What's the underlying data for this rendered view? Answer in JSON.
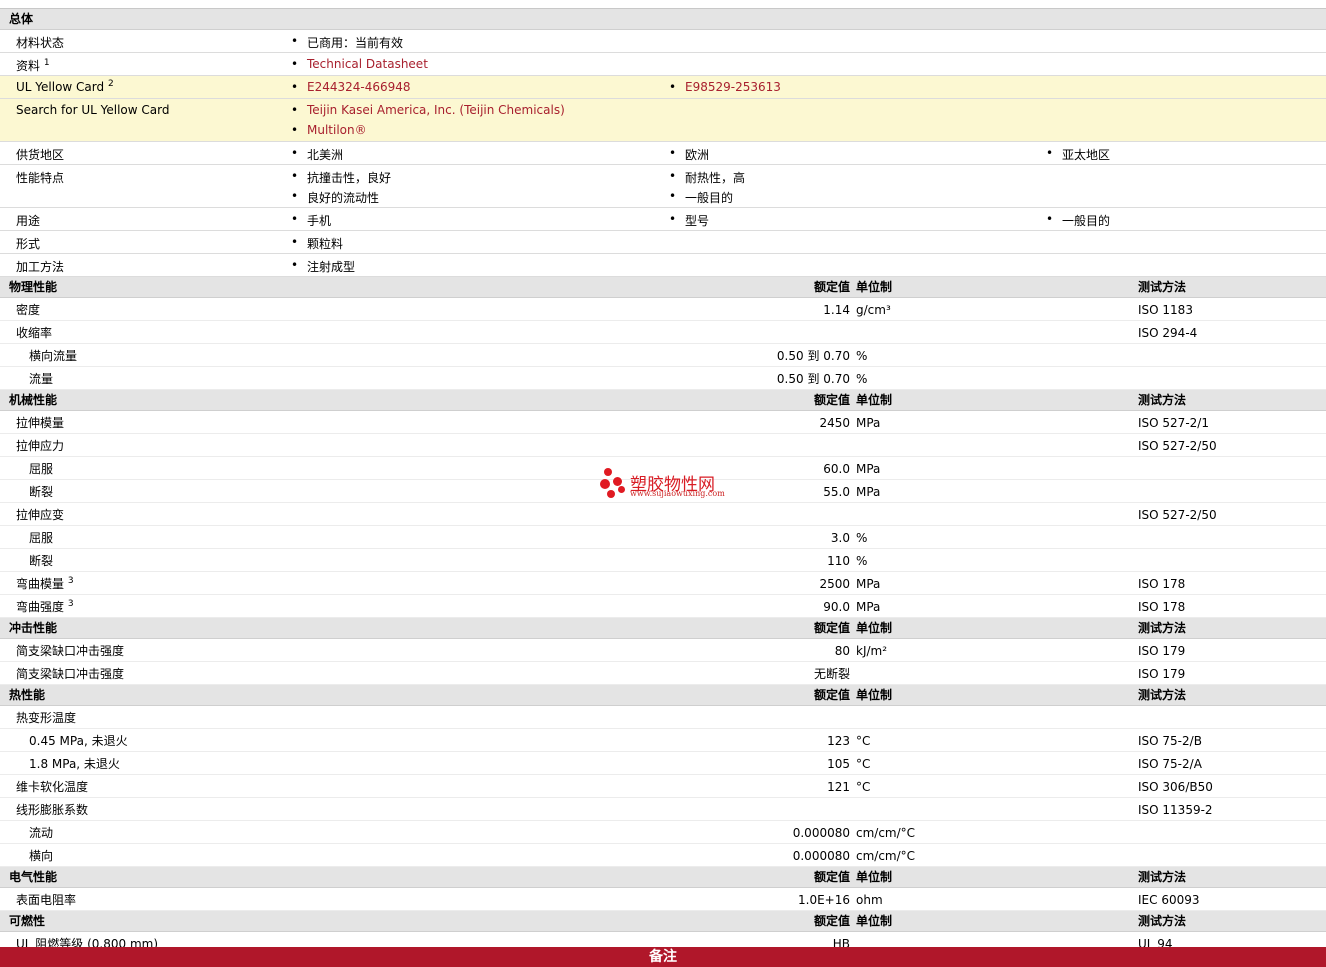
{
  "general": {
    "header": "总体",
    "material_status": {
      "label": "材料状态",
      "value": "已商用：当前有效"
    },
    "datasheet": {
      "label": "资料",
      "sup": "1",
      "link": "Technical Datasheet"
    },
    "ul_card": {
      "label": "UL Yellow Card",
      "sup": "2",
      "links": [
        "E244324-466948",
        "E98529-253613"
      ]
    },
    "search_ul": {
      "label": "Search for UL Yellow Card",
      "links": [
        "Teijin Kasei America, Inc. (Teijin Chemicals)",
        "Multilon®"
      ]
    },
    "supply": {
      "label": "供货地区",
      "items": [
        "北美洲",
        "欧洲",
        "亚太地区"
      ]
    },
    "features": {
      "label": "性能特点",
      "items": [
        "抗撞击性，良好",
        "耐热性，高",
        "良好的流动性",
        "一般目的"
      ]
    },
    "uses": {
      "label": "用途",
      "items": [
        "手机",
        "型号",
        "一般目的"
      ]
    },
    "form": {
      "label": "形式",
      "items": [
        "颗粒料"
      ]
    },
    "processing": {
      "label": "加工方法",
      "items": [
        "注射成型"
      ]
    }
  },
  "columns": {
    "nominal": "额定值",
    "unit": "单位制",
    "test": "测试方法"
  },
  "physical": {
    "header": "物理性能",
    "rows": [
      {
        "label": "密度",
        "nominal": "1.14",
        "unit": "g/cm³",
        "test": "ISO 1183"
      },
      {
        "label": "收缩率",
        "nominal": "",
        "unit": "",
        "test": "ISO 294-4"
      },
      {
        "label": "横向流量",
        "nominal": "0.50 到  0.70",
        "unit": "%",
        "test": ""
      },
      {
        "label": "流量",
        "nominal": "0.50 到  0.70",
        "unit": "%",
        "test": ""
      }
    ]
  },
  "mechanical": {
    "header": "机械性能",
    "rows": [
      {
        "label": "拉伸模量",
        "nominal": "2450",
        "unit": "MPa",
        "test": "ISO 527-2/1"
      },
      {
        "label": "拉伸应力",
        "nominal": "",
        "unit": "",
        "test": "ISO 527-2/50"
      },
      {
        "label": "屈服",
        "nominal": "60.0",
        "unit": "MPa",
        "test": ""
      },
      {
        "label": "断裂",
        "nominal": "55.0",
        "unit": "MPa",
        "test": ""
      },
      {
        "label": "拉伸应变",
        "nominal": "",
        "unit": "",
        "test": "ISO 527-2/50"
      },
      {
        "label": "屈服",
        "nominal": "3.0",
        "unit": "%",
        "test": ""
      },
      {
        "label": "断裂",
        "nominal": "110",
        "unit": "%",
        "test": ""
      },
      {
        "label": "弯曲模量",
        "sup": "3",
        "nominal": "2500",
        "unit": "MPa",
        "test": "ISO 178"
      },
      {
        "label": "弯曲强度",
        "sup": "3",
        "nominal": "90.0",
        "unit": "MPa",
        "test": "ISO 178"
      }
    ]
  },
  "impact": {
    "header": "冲击性能",
    "rows": [
      {
        "label": "简支梁缺口冲击强度",
        "nominal": "80",
        "unit": "kJ/m²",
        "test": "ISO 179"
      },
      {
        "label": "简支梁缺口冲击强度",
        "nominal": "无断裂",
        "unit": "",
        "test": "ISO 179"
      }
    ]
  },
  "thermal": {
    "header": "热性能",
    "rows": [
      {
        "label": "热变形温度",
        "nominal": "",
        "unit": "",
        "test": ""
      },
      {
        "label": "0.45 MPa, 未退火",
        "nominal": "123",
        "unit": "°C",
        "test": "ISO 75-2/B"
      },
      {
        "label": "1.8 MPa, 未退火",
        "nominal": "105",
        "unit": "°C",
        "test": "ISO 75-2/A"
      },
      {
        "label": "维卡软化温度",
        "nominal": "121",
        "unit": "°C",
        "test": "ISO 306/B50"
      },
      {
        "label": "线形膨胀系数",
        "nominal": "",
        "unit": "",
        "test": "ISO 11359-2"
      },
      {
        "label": "流动",
        "nominal": "0.000080",
        "unit": "cm/cm/°C",
        "test": ""
      },
      {
        "label": "横向",
        "nominal": "0.000080",
        "unit": "cm/cm/°C",
        "test": ""
      }
    ]
  },
  "electrical": {
    "header": "电气性能",
    "rows": [
      {
        "label": "表面电阻率",
        "nominal": "1.0E+16",
        "unit": "ohm",
        "test": "IEC 60093"
      }
    ]
  },
  "flammability": {
    "header": "可燃性",
    "rows": [
      {
        "label": "UL 阻燃等级  (0.800 mm)",
        "nominal": "HB",
        "unit": "",
        "test": "UL 94"
      }
    ]
  },
  "footer": {
    "label": "备注"
  },
  "watermark": {
    "name": "塑胶物性网",
    "url": "www.sujiaowuxing.com"
  },
  "colors": {
    "link": "#a8202e",
    "highlight": "#fcf8d2",
    "section": "#e4e4e4",
    "footer": "#b0172a"
  }
}
